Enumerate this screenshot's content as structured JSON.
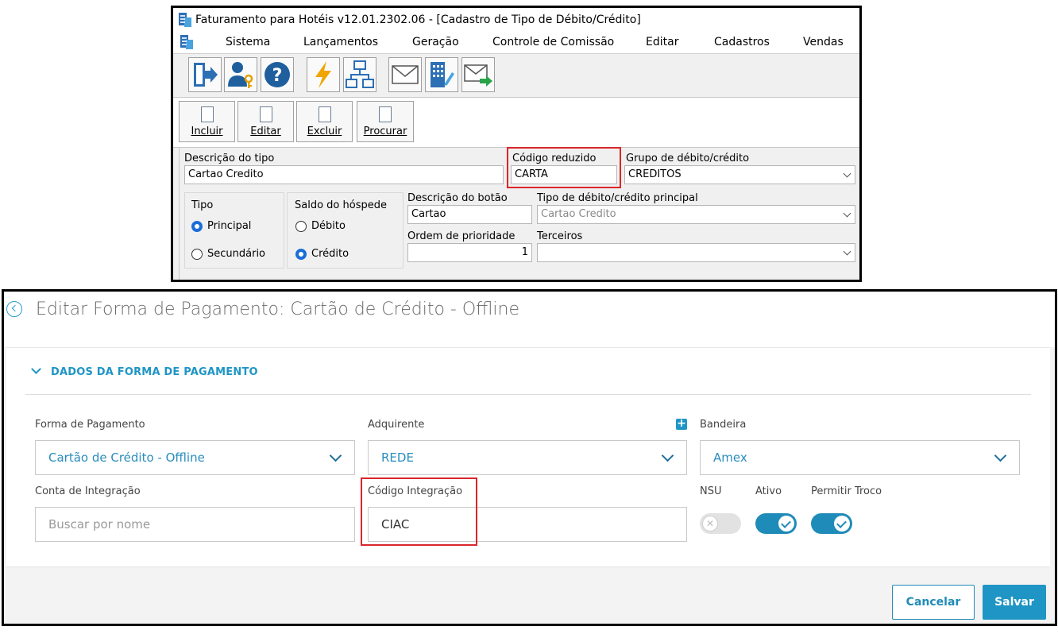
{
  "legacy": {
    "title": "Faturamento para Hotéis v12.01.2302.06 - [Cadastro de Tipo de Débito/Crédito]",
    "menu": [
      "Sistema",
      "Lançamentos",
      "Geração",
      "Controle de Comissão",
      "Editar",
      "Cadastros",
      "Vendas"
    ],
    "toolbar_icons": [
      "exit-icon",
      "user-key-icon",
      "help-icon",
      "lightning-icon",
      "diagram-icon",
      "envelope-icon",
      "building-edit-icon",
      "envelope-send-icon"
    ],
    "actions": {
      "incluir": "Incluir",
      "editar": "Editar",
      "excluir": "Excluir",
      "procurar": "Procurar"
    },
    "form": {
      "descricao_tipo_label": "Descrição do tipo",
      "descricao_tipo_value": "Cartao Credito",
      "codigo_reduzido_label": "Código reduzido",
      "codigo_reduzido_value": "CARTA",
      "grupo_label": "Grupo de débito/crédito",
      "grupo_value": "CREDITOS",
      "tipo_label": "Tipo",
      "tipo_principal": "Principal",
      "tipo_secundario": "Secundário",
      "saldo_label": "Saldo do hóspede",
      "saldo_debito": "Débito",
      "saldo_credito": "Crédito",
      "descricao_botao_label": "Descrição do botão",
      "descricao_botao_value": "Cartao",
      "tipo_principal_label": "Tipo de débito/crédito principal",
      "tipo_principal_value": "Cartao Credito",
      "ordem_label": "Ordem de prioridade",
      "ordem_value": "1",
      "terceiros_label": "Terceiros",
      "terceiros_value": ""
    }
  },
  "modern": {
    "page_title": "Editar Forma de Pagamento: Cartão de Crédito - Offline",
    "section_title": "DADOS DA FORMA DE PAGAMENTO",
    "forma_pagamento_label": "Forma de Pagamento",
    "forma_pagamento_value": "Cartão de Crédito - Offline",
    "adquirente_label": "Adquirente",
    "adquirente_value": "REDE",
    "bandeira_label": "Bandeira",
    "bandeira_value": "Amex",
    "conta_label": "Conta de Integração",
    "conta_placeholder": "Buscar por nome",
    "codigo_label": "Código Integração",
    "codigo_value": "CIAC",
    "nsu_label": "NSU",
    "ativo_label": "Ativo",
    "troco_label": "Permitir Troco",
    "cancel_label": "Cancelar",
    "save_label": "Salvar",
    "accent_color": "#1f95c5",
    "highlight_color": "#d9262b"
  }
}
